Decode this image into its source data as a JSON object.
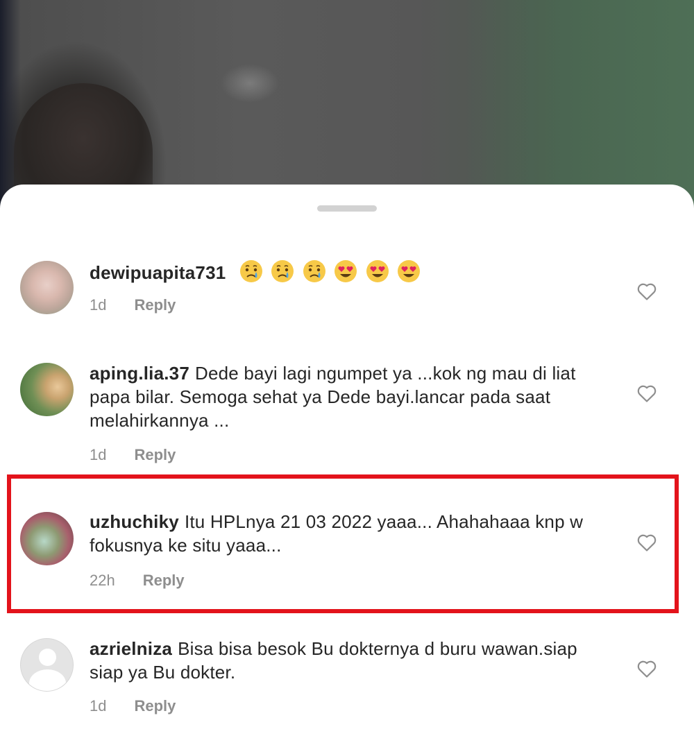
{
  "comments": [
    {
      "username": "dewipuapita731",
      "text": "",
      "emojis": [
        "crying-face",
        "crying-face",
        "crying-face",
        "heart-eyes-face",
        "heart-eyes-face",
        "heart-eyes-face"
      ],
      "time": "1d",
      "reply_label": "Reply"
    },
    {
      "username": "aping.lia.37",
      "text": "Dede bayi lagi ngumpet ya ...kok ng mau di liat papa bilar. Semoga sehat ya Dede bayi.lancar pada saat melahirkannya ...",
      "time": "1d",
      "reply_label": "Reply"
    },
    {
      "username": "uzhuchiky",
      "text": "Itu HPLnya 21 03 2022 yaaa... Ahahahaaa knp w fokusnya ke situ yaaa...",
      "time": "22h",
      "reply_label": "Reply",
      "highlighted": true
    },
    {
      "username": "azrielniza",
      "text": "Bisa bisa besok Bu dokternya d buru wawan.siap siap ya Bu dokter.",
      "time": "1d",
      "reply_label": "Reply"
    }
  ],
  "icons": {
    "like": "heart-outline-icon",
    "drag_handle": "sheet-handle"
  },
  "colors": {
    "highlight_border": "#e3131b",
    "meta_text": "#8e8e8e",
    "body_text": "#262626"
  }
}
